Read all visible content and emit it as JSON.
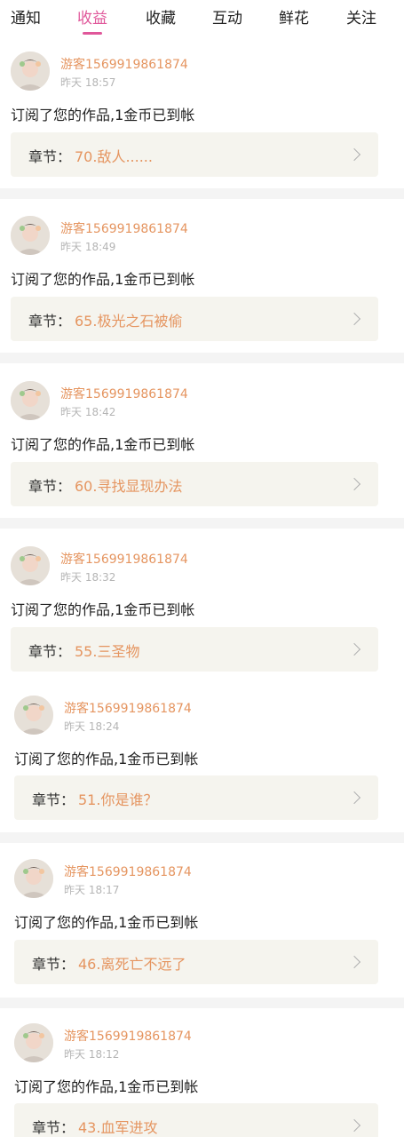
{
  "tabs": [
    {
      "label": "通知"
    },
    {
      "label": "收益",
      "active": true
    },
    {
      "label": "收藏"
    },
    {
      "label": "互动"
    },
    {
      "label": "鲜花"
    },
    {
      "label": "关注"
    }
  ],
  "colors": {
    "accent": "#e0579a",
    "username": "#e59560",
    "chapter_bg": "#f5f4ee",
    "separator": "#f4f4f4"
  },
  "notifications": [
    {
      "username": "游客1569919861874",
      "time": "昨天 18:57",
      "message": "订阅了您的作品,1金币已到帐",
      "chapter_label": "章节：",
      "chapter_title": "70.敌人......"
    },
    {
      "username": "游客1569919861874",
      "time": "昨天 18:49",
      "message": "订阅了您的作品,1金币已到帐",
      "chapter_label": "章节：",
      "chapter_title": "65.极光之石被偷"
    },
    {
      "username": "游客1569919861874",
      "time": "昨天 18:42",
      "message": "订阅了您的作品,1金币已到帐",
      "chapter_label": "章节：",
      "chapter_title": "60.寻找显现办法"
    },
    {
      "username": "游客1569919861874",
      "time": "昨天 18:32",
      "message": "订阅了您的作品,1金币已到帐",
      "chapter_label": "章节：",
      "chapter_title": "55.三圣物"
    },
    {
      "username": "游客1569919861874",
      "time": "昨天 18:24",
      "message": "订阅了您的作品,1金币已到帐",
      "chapter_label": "章节：",
      "chapter_title": "51.你是谁？"
    },
    {
      "username": "游客1569919861874",
      "time": "昨天 18:17",
      "message": "订阅了您的作品,1金币已到帐",
      "chapter_label": "章节：",
      "chapter_title": "46.离死亡不远了"
    },
    {
      "username": "游客1569919861874",
      "time": "昨天 18:12",
      "message": "订阅了您的作品,1金币已到帐",
      "chapter_label": "章节：",
      "chapter_title": "43.血军进攻"
    }
  ]
}
